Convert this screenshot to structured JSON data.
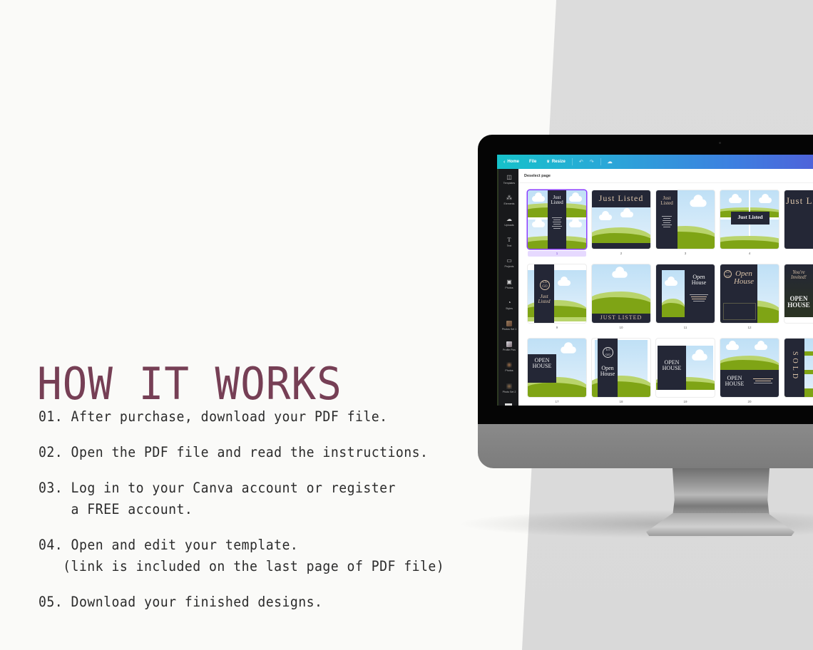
{
  "heading": "HOW IT WORKS",
  "steps": [
    {
      "num": "01.",
      "text": "After purchase, download your PDF file.",
      "cont": ""
    },
    {
      "num": "02.",
      "text": "Open the PDF file and read the instructions.",
      "cont": ""
    },
    {
      "num": "03.",
      "text": "Log in to your Canva account or register",
      "cont": "    a FREE account."
    },
    {
      "num": "04.",
      "text": "Open and edit your template.",
      "cont": "   (link is included on the last page of PDF file)"
    },
    {
      "num": "05.",
      "text": "Download your finished designs.",
      "cont": ""
    }
  ],
  "colors": {
    "heading": "#763f55",
    "toolbar_start": "#16c2ca",
    "toolbar_end": "#4e63da",
    "selection": "#8b3dff",
    "navy": "#242736",
    "gold_text": "#d9c2a8",
    "grass": "#7fa415"
  },
  "canva": {
    "toolbar": {
      "back_icon": "chevron-left-icon",
      "home": "Home",
      "file": "File",
      "resize_icon": "crown-icon",
      "resize": "Resize",
      "undo_icon": "undo-icon",
      "redo_icon": "redo-icon",
      "save_icon": "cloud-check-icon",
      "undo_glyph": "↶",
      "redo_glyph": "↷",
      "cloud_glyph": "☁",
      "back_glyph": "‹",
      "resize_glyph": "♛"
    },
    "sidebar": [
      {
        "label": "Templates",
        "icon": "templates-icon",
        "glyph": "◫"
      },
      {
        "label": "Elements",
        "icon": "elements-icon",
        "glyph": "⁂"
      },
      {
        "label": "Uploads",
        "icon": "upload-cloud-icon",
        "glyph": "☁"
      },
      {
        "label": "Text",
        "icon": "text-icon",
        "glyph": "T"
      },
      {
        "label": "Projects",
        "icon": "folder-icon",
        "glyph": "▭"
      },
      {
        "label": "Photos",
        "icon": "photos-icon",
        "glyph": "▣"
      },
      {
        "label": "Styles",
        "icon": "styles-icon",
        "glyph": "◔"
      },
      {
        "label": "Photos Set 1",
        "icon": "photo-thumbnail-icon",
        "glyph": ""
      },
      {
        "label": "Profile Pics",
        "icon": "photo-thumbnail-icon",
        "glyph": ""
      },
      {
        "label": "Photos",
        "icon": "photo-thumbnail-icon",
        "glyph": ""
      },
      {
        "label": "Photo Set 2",
        "icon": "photo-thumbnail-icon",
        "glyph": ""
      }
    ],
    "header": "Deselect page",
    "pages": [
      {
        "num": "1",
        "title": "Just Listed",
        "selected": true
      },
      {
        "num": "2",
        "title": "Just Listed"
      },
      {
        "num": "3",
        "title": "Just Listed"
      },
      {
        "num": "4",
        "title": "Just Listed"
      },
      {
        "num": "",
        "title": "Just Listed"
      },
      {
        "num": "9",
        "title": "Just Listed",
        "logo": "LO GO"
      },
      {
        "num": "10",
        "title": "JUST LISTED"
      },
      {
        "num": "11",
        "title": "Open House"
      },
      {
        "num": "12",
        "title": "Open House",
        "logo": "LO GO"
      },
      {
        "num": "",
        "title": "OPEN HOUSE",
        "script": "You're Invited!"
      },
      {
        "num": "17",
        "title": "OPEN HOUSE"
      },
      {
        "num": "18",
        "title": "Open House",
        "logo": "LO GO"
      },
      {
        "num": "19",
        "title": "OPEN HOUSE"
      },
      {
        "num": "20",
        "title": "OPEN HOUSE"
      },
      {
        "num": "",
        "title": "SOLD"
      }
    ]
  }
}
